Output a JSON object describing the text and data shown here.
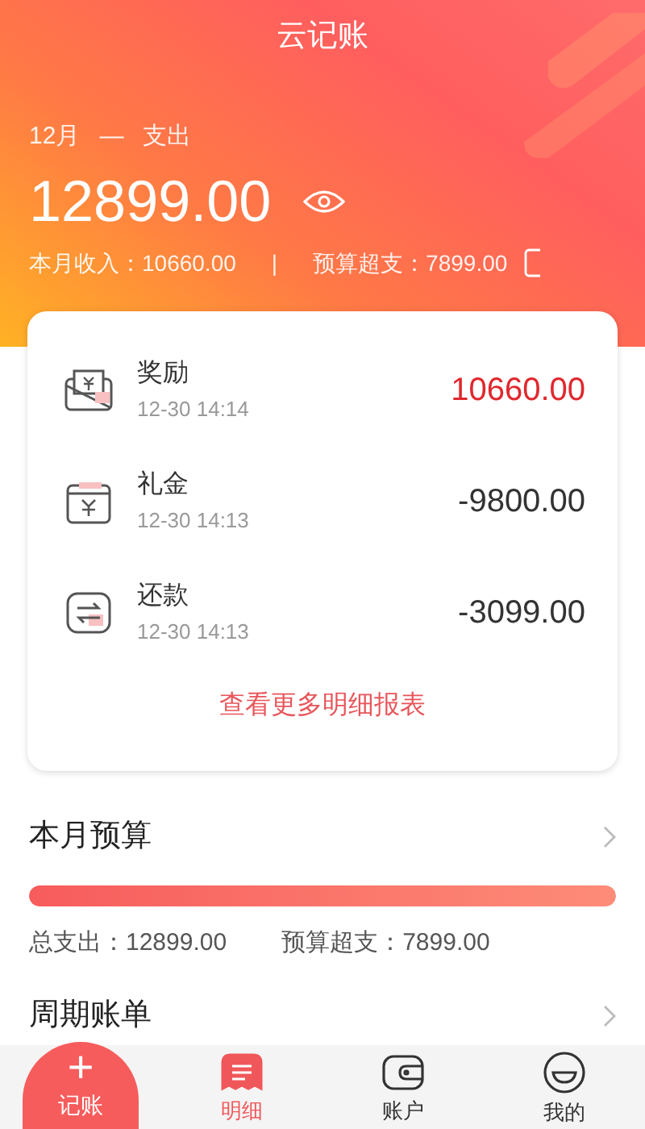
{
  "app_title": "云记账",
  "summary": {
    "period": "12月",
    "separator": "—",
    "type": "支出",
    "amount": "12899.00",
    "income": "本月收入：10660.00",
    "divider": "|",
    "overspend": "预算超支：7899.00"
  },
  "transactions": [
    {
      "title": "奖励",
      "time": "12-30 14:14",
      "amount": "10660.00",
      "kind": "income"
    },
    {
      "title": "礼金",
      "time": "12-30 14:13",
      "amount": "-9800.00",
      "kind": "expense"
    },
    {
      "title": "还款",
      "time": "12-30 14:13",
      "amount": "-3099.00",
      "kind": "expense"
    }
  ],
  "more_link": "查看更多明细报表",
  "budget": {
    "title": "本月预算",
    "level": 1,
    "total": "总支出：12899.00",
    "overspend": "预算超支：7899.00"
  },
  "recurring": {
    "title": "周期账单"
  },
  "add_button": {
    "icon": "+",
    "label": "记账"
  },
  "tabs": [
    {
      "label": "明细",
      "selected": true
    },
    {
      "label": "账户",
      "selected": false
    },
    {
      "label": "我的",
      "selected": false
    }
  ]
}
